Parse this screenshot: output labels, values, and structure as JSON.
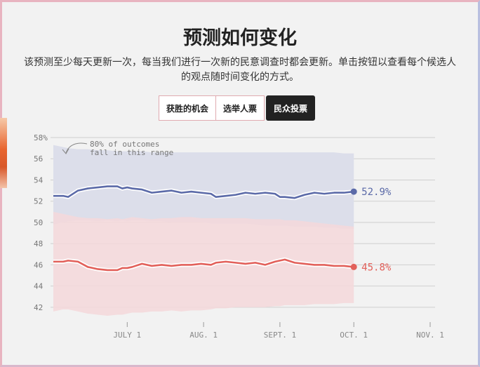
{
  "page": {
    "title": "预测如何变化",
    "description": "该预测至少每天更新一次，每当我们进行一次新的民意调查时都会更新。单击按钮以查看每个候选人的观点随时间变化的方式。"
  },
  "tabs": [
    {
      "label": "获胜的机会",
      "active": false
    },
    {
      "label": "选举人票",
      "active": false
    },
    {
      "label": "民众投票",
      "active": true
    }
  ],
  "colors": {
    "blue": "#5b6aa8",
    "red": "#e2605a",
    "blue_band": "#dcdeea",
    "red_band": "#f4d8da"
  },
  "chart_data": {
    "type": "line",
    "annotation": "80% of outcomes\nfall in this range",
    "ylim": [
      41,
      58
    ],
    "y_ticks": [
      42,
      44,
      46,
      48,
      50,
      52,
      54,
      56,
      58
    ],
    "y_tick_labels": [
      "42",
      "44",
      "46",
      "48",
      "50",
      "52",
      "54",
      "56",
      "58%"
    ],
    "x_ticks": [
      {
        "label": "JULY 1",
        "day": 30
      },
      {
        "label": "AUG. 1",
        "day": 61
      },
      {
        "label": "SEPT. 1",
        "day": 92
      },
      {
        "label": "OCT. 1",
        "day": 122
      },
      {
        "label": "NOV. 1",
        "day": 153
      }
    ],
    "x_range": [
      0,
      155
    ],
    "series": [
      {
        "color_key": "blue",
        "label": "52.9%",
        "x": [
          0,
          4,
          6,
          10,
          14,
          18,
          22,
          26,
          28,
          30,
          32,
          36,
          40,
          44,
          48,
          52,
          56,
          60,
          64,
          66,
          70,
          74,
          78,
          82,
          86,
          90,
          92,
          94,
          98,
          102,
          106,
          110,
          114,
          118,
          122
        ],
        "y": [
          52.5,
          52.5,
          52.4,
          53.0,
          53.2,
          53.3,
          53.4,
          53.4,
          53.2,
          53.3,
          53.2,
          53.1,
          52.8,
          52.9,
          53.0,
          52.8,
          52.9,
          52.8,
          52.7,
          52.4,
          52.5,
          52.6,
          52.8,
          52.7,
          52.8,
          52.7,
          52.4,
          52.4,
          52.3,
          52.6,
          52.8,
          52.7,
          52.8,
          52.8,
          52.9
        ],
        "band_upper": [
          57.3,
          57.1,
          57.0,
          56.9,
          56.9,
          56.8,
          56.8,
          56.7,
          56.7,
          56.7,
          56.7,
          56.7,
          56.6,
          56.6,
          56.6,
          56.6,
          56.6,
          56.6,
          56.6,
          56.6,
          56.6,
          56.6,
          56.6,
          56.6,
          56.6,
          56.6,
          56.6,
          56.6,
          56.6,
          56.6,
          56.6,
          56.6,
          56.6,
          56.5,
          56.5
        ],
        "band_lower": [
          49.8,
          50.0,
          50.1,
          50.2,
          50.2,
          50.1,
          50.2,
          50.1,
          50.2,
          50.1,
          50.2,
          50.2,
          50.1,
          50.1,
          50.0,
          50.0,
          50.0,
          50.0,
          49.9,
          49.9,
          49.9,
          49.9,
          49.9,
          49.8,
          49.7,
          49.7,
          49.7,
          49.7,
          49.6,
          49.6,
          49.6,
          49.5,
          49.5,
          49.4,
          49.4
        ]
      },
      {
        "color_key": "red",
        "label": "45.8%",
        "x": [
          0,
          4,
          6,
          10,
          14,
          18,
          22,
          26,
          28,
          30,
          32,
          36,
          40,
          44,
          48,
          52,
          56,
          60,
          64,
          66,
          70,
          74,
          78,
          82,
          86,
          90,
          92,
          94,
          98,
          102,
          106,
          110,
          114,
          118,
          122
        ],
        "y": [
          46.3,
          46.3,
          46.4,
          46.3,
          45.8,
          45.6,
          45.5,
          45.5,
          45.7,
          45.7,
          45.8,
          46.1,
          45.9,
          46.0,
          45.9,
          46.0,
          46.0,
          46.1,
          46.0,
          46.2,
          46.3,
          46.2,
          46.1,
          46.2,
          46.0,
          46.3,
          46.4,
          46.5,
          46.2,
          46.1,
          46.0,
          46.0,
          45.9,
          45.9,
          45.8
        ],
        "band_upper": [
          51.0,
          50.8,
          50.7,
          50.5,
          50.4,
          50.4,
          50.3,
          50.4,
          50.3,
          50.4,
          50.5,
          50.4,
          50.3,
          50.4,
          50.4,
          50.5,
          50.5,
          50.4,
          50.4,
          50.4,
          50.4,
          50.4,
          50.4,
          50.3,
          50.3,
          50.3,
          50.3,
          50.2,
          50.2,
          50.1,
          50.0,
          49.9,
          49.8,
          49.7,
          49.6
        ],
        "band_lower": [
          41.6,
          41.8,
          41.8,
          41.6,
          41.4,
          41.3,
          41.2,
          41.3,
          41.3,
          41.4,
          41.5,
          41.5,
          41.6,
          41.6,
          41.7,
          41.6,
          41.7,
          41.7,
          41.8,
          41.9,
          41.9,
          42.0,
          42.0,
          42.0,
          42.0,
          42.1,
          42.1,
          42.2,
          42.2,
          42.2,
          42.3,
          42.3,
          42.3,
          42.4,
          42.4
        ]
      }
    ]
  }
}
